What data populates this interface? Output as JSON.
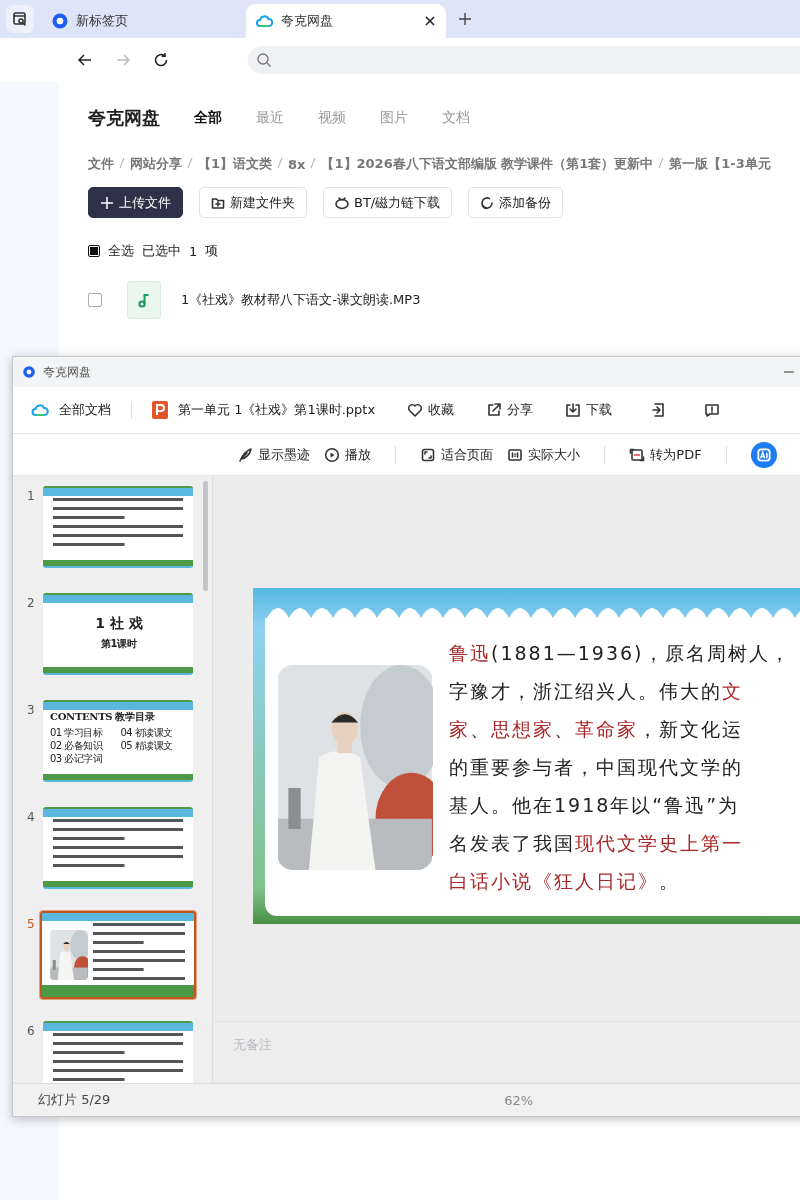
{
  "browser": {
    "tabs": [
      {
        "title": "新标签页",
        "selected": false
      },
      {
        "title": "夸克网盘",
        "selected": true
      }
    ]
  },
  "drive": {
    "logo": "夸克网盘",
    "nav": [
      {
        "label": "全部",
        "selected": true
      },
      {
        "label": "最近",
        "selected": false
      },
      {
        "label": "视频",
        "selected": false
      },
      {
        "label": "图片",
        "selected": false
      },
      {
        "label": "文档",
        "selected": false
      }
    ],
    "breadcrumb": [
      "文件",
      "网站分享",
      "【1】语文类",
      "8x",
      "【1】2026春八下语文部编版 教学课件（第1套）更新中",
      "第一版【1-3单元"
    ],
    "actions": [
      {
        "label": "上传文件",
        "kind": "primary"
      },
      {
        "label": "新建文件夹",
        "kind": "folder"
      },
      {
        "label": "BT/磁力链下载",
        "kind": "bt"
      },
      {
        "label": "添加备份",
        "kind": "backup"
      }
    ],
    "selection": {
      "select_all": "全选",
      "selected_text": "已选中",
      "count": "1",
      "unit": "项",
      "checked": true
    },
    "files": [
      {
        "name": "1《社戏》教材帮八下语文-课文朗读.MP3",
        "checked": false
      }
    ]
  },
  "viewer": {
    "title": "夸克网盘",
    "root": "全部文档",
    "file": "第一单元 1《社戏》第1课时.pptx",
    "top_actions": [
      {
        "label": "收藏"
      },
      {
        "label": "分享"
      },
      {
        "label": "下载"
      }
    ],
    "tools": [
      {
        "label": "显示墨迹"
      },
      {
        "label": "播放"
      },
      {
        "label": "适合页面"
      },
      {
        "label": "实际大小"
      },
      {
        "label": "转为PDF"
      }
    ],
    "thumbnails": [
      {
        "number": "1",
        "kind": "text",
        "selected": false
      },
      {
        "number": "2",
        "kind": "title",
        "heading": "1 社 戏",
        "subtitle": "第1课时",
        "selected": false
      },
      {
        "number": "3",
        "kind": "contents",
        "heading": "CONTENTS 教学目录",
        "items": [
          "01 学习目标",
          "02 必备知识",
          "03 必记字词",
          "04 初读课文",
          "05 精读课文"
        ],
        "selected": false
      },
      {
        "number": "4",
        "kind": "text",
        "selected": false
      },
      {
        "number": "5",
        "kind": "portrait",
        "selected": true
      },
      {
        "number": "6",
        "kind": "text",
        "selected": false
      }
    ],
    "slide": {
      "lines": [
        [
          {
            "text": "鲁迅",
            "highlighted": true
          },
          {
            "text": "(1881—1936)，原名周树人，",
            "highlighted": false
          }
        ],
        [
          {
            "text": "字豫才，浙江绍兴人。伟大的",
            "highlighted": false
          },
          {
            "text": "文",
            "highlighted": true
          }
        ],
        [
          {
            "text": "家",
            "highlighted": true
          },
          {
            "text": "、",
            "highlighted": false
          },
          {
            "text": "思想家",
            "highlighted": true
          },
          {
            "text": "、",
            "highlighted": false
          },
          {
            "text": "革命家",
            "highlighted": true
          },
          {
            "text": "，新文化运",
            "highlighted": false
          }
        ],
        [
          {
            "text": "的重要参与者，中国现代文学的",
            "highlighted": false
          }
        ],
        [
          {
            "text": "基人。他在1918年以“鲁迅”为",
            "highlighted": false
          }
        ],
        [
          {
            "text": "名发表了我国",
            "highlighted": false
          },
          {
            "text": "现代文学史上第一",
            "highlighted": true
          }
        ],
        [
          {
            "text": "白话小说《狂人日记》",
            "highlighted": true
          },
          {
            "text": "。",
            "highlighted": false
          }
        ]
      ]
    },
    "notes": "无备注",
    "status": {
      "slide_count": "幻灯片 5/29",
      "zoom": "62%"
    }
  }
}
